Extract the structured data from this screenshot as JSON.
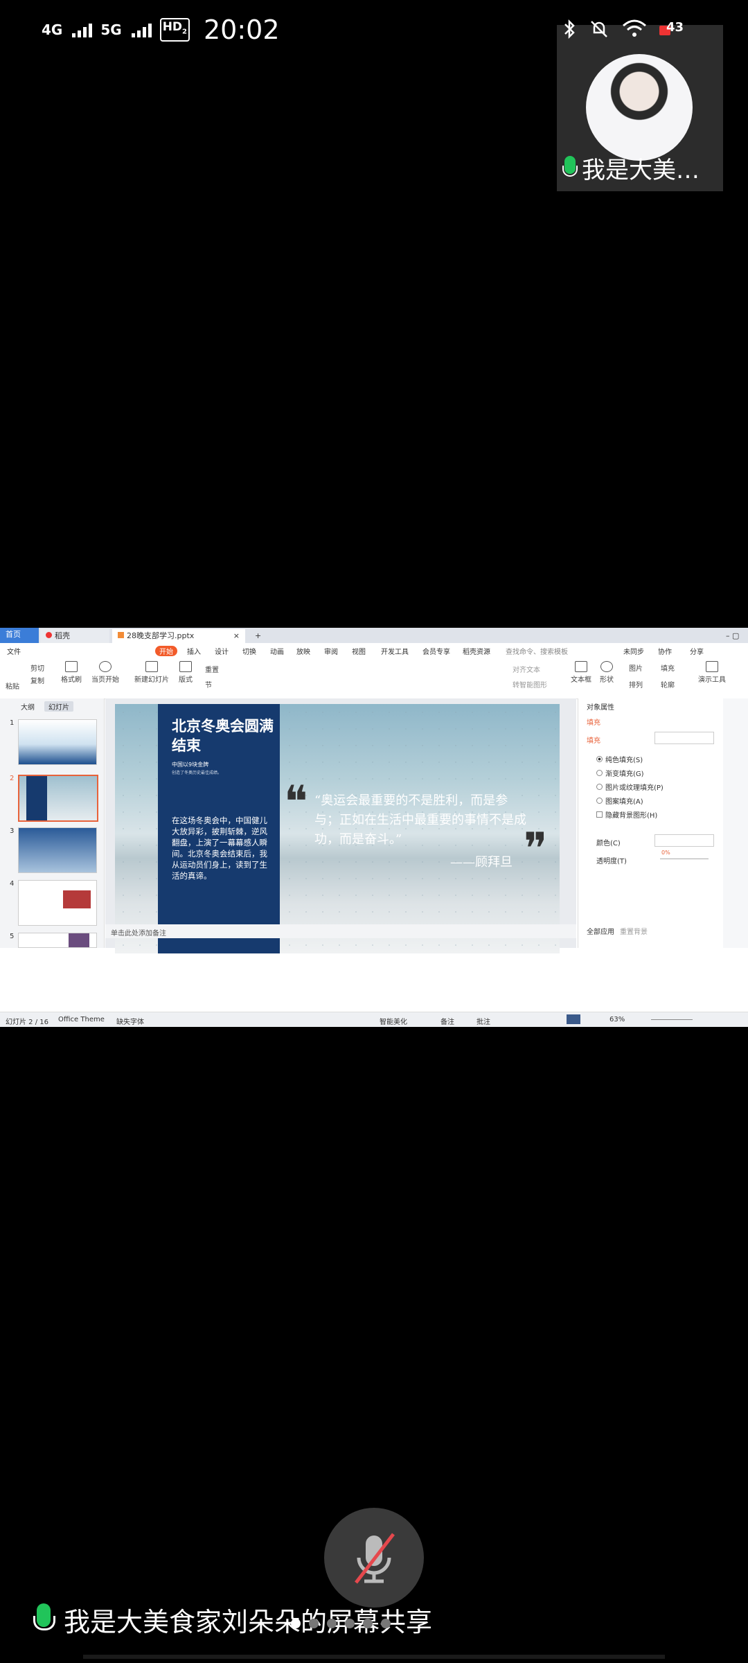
{
  "status": {
    "net1": "4G",
    "net2": "5G",
    "hd": "HD",
    "hd_sub": "2",
    "time": "20:02",
    "battery": "43"
  },
  "pip": {
    "name": "我是大美…"
  },
  "app": {
    "tabs": [
      "首页",
      "稻壳",
      "28晚支部学习.pptx"
    ],
    "menu": [
      "文件",
      "开始",
      "插入",
      "设计",
      "切换",
      "动画",
      "放映",
      "审阅",
      "视图",
      "开发工具",
      "会员专享",
      "稻壳资源"
    ],
    "search_placeholder": "查找命令、搜索模板",
    "right_menu": [
      "未同步",
      "协作",
      "分享"
    ],
    "ribbon_buttons": [
      "剪切",
      "复制",
      "格式刷",
      "粘贴",
      "当页开始",
      "新建幻灯片",
      "版式",
      "节",
      "重置",
      "文本框",
      "形状",
      "图片",
      "填充",
      "排列",
      "轮廓",
      "演示工具",
      "对齐文本",
      "转智能图形"
    ],
    "left_tabs": [
      "大纲",
      "幻灯片"
    ],
    "thumb_numbers": [
      "1",
      "2",
      "3",
      "4",
      "5"
    ],
    "notes_placeholder": "单击此处添加备注"
  },
  "slide": {
    "title": "北京冬奥会圆满结束",
    "sub": "中国以9块金牌",
    "sub2": "创造了冬奥历史最佳成绩。",
    "body": "在这场冬奥会中，中国健儿大放异彩，披荆斩棘，逆风翻盘，上演了一幕幕感人瞬间。北京冬奥会结束后，我从运动员们身上，读到了生活的真谛。",
    "quote_open": "❝",
    "quote_close": "❞",
    "quote": "“奥运会最重要的不是胜利，而是参与；正如在生活中最重要的事情不是成功，而是奋斗。”",
    "author": "——顾拜旦"
  },
  "right_panel": {
    "title": "对象属性",
    "tab": "填充",
    "section": "填充",
    "options": [
      "纯色填充(S)",
      "渐变填充(G)",
      "图片或纹理填充(P)",
      "图案填充(A)",
      "隐藏背景图形(H)"
    ],
    "color_label": "颜色(C)",
    "opacity_label": "透明度(T)",
    "opacity_value": "0%",
    "apply_all": "全部应用",
    "reset_bg": "重置背景"
  },
  "statusbar": {
    "slide_count": "幻灯片 2 / 16",
    "theme": "Office Theme",
    "font_missing": "缺失字体",
    "beautify": "智能美化",
    "notes": "备注",
    "comments": "批注",
    "zoom": "63%"
  },
  "bottom": {
    "share_text": "我是大美食家刘朵朵的屏幕共享"
  }
}
